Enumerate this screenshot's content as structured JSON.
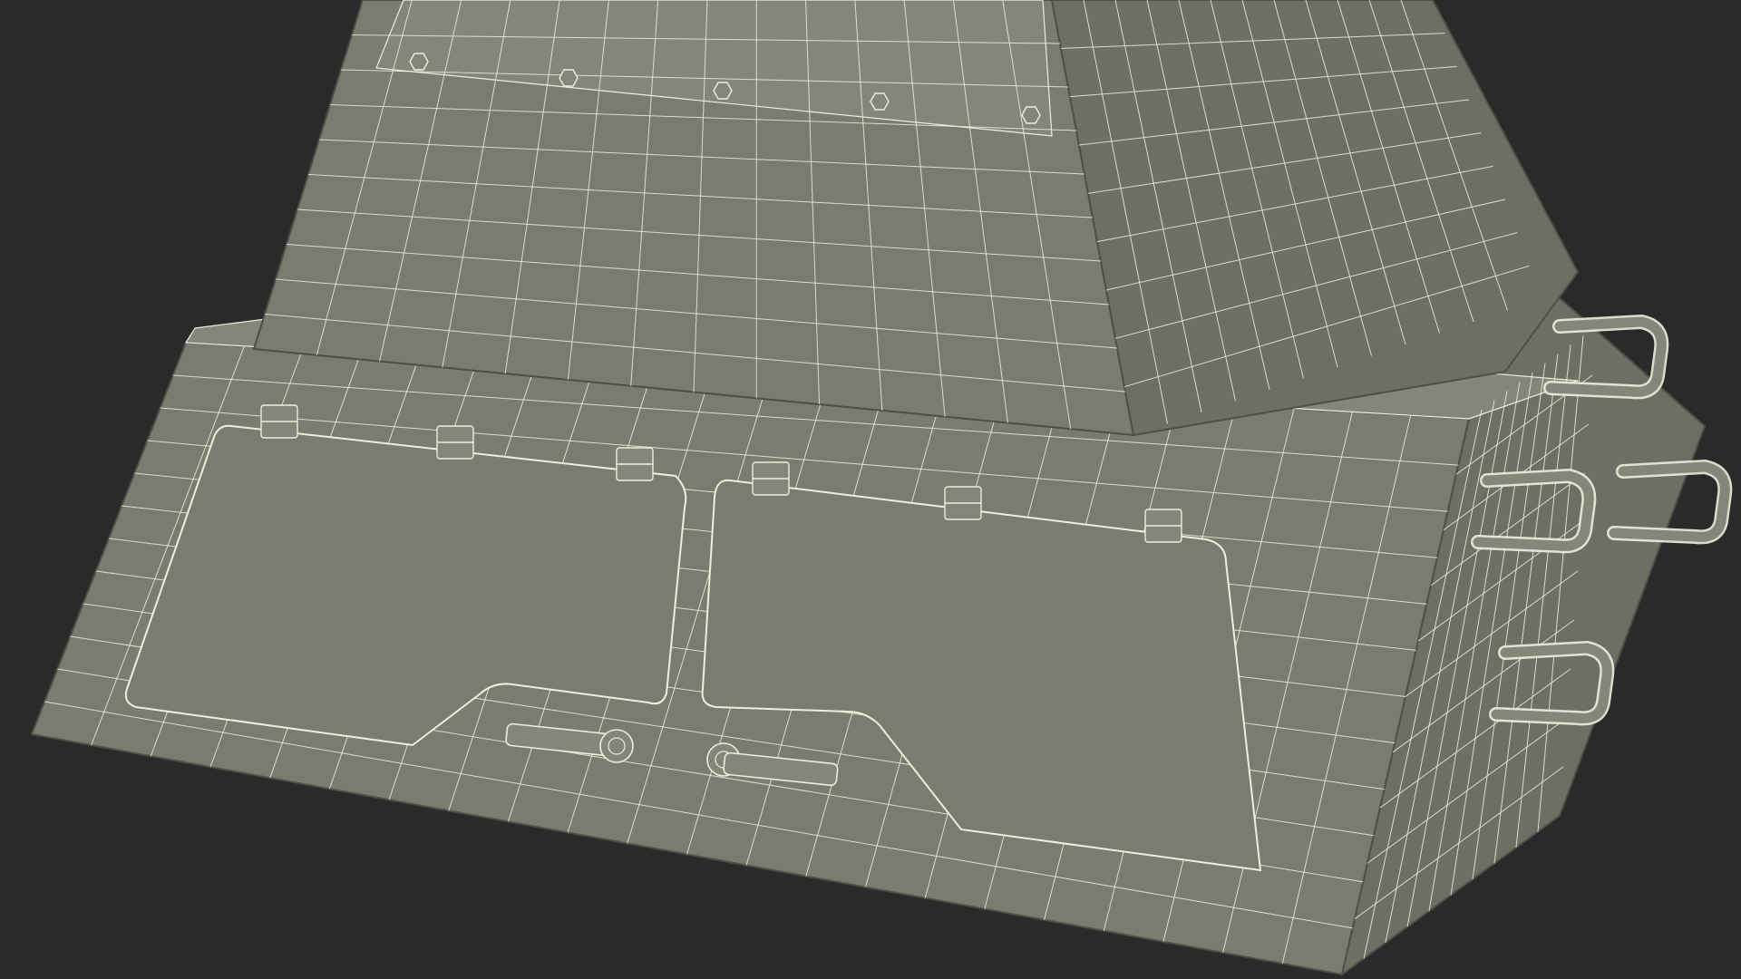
{
  "render": {
    "background_color": "#2a2a2a",
    "surface_color": "#7b7b70",
    "surface_shade_color": "#6e6e64",
    "surface_light_color": "#85857a",
    "wire_color": "#eeeede",
    "edge_dark_color": "#4f4f47"
  },
  "model": {
    "subject": "wireframe-3d-model",
    "parts": [
      "upper-housing",
      "lower-base",
      "hinged-panel-left",
      "hinged-panel-right",
      "hinges",
      "latch-left",
      "latch-right",
      "side-handles",
      "bolts"
    ],
    "hinge_count": 6,
    "bolt_count": 5,
    "handle_count": 4
  }
}
